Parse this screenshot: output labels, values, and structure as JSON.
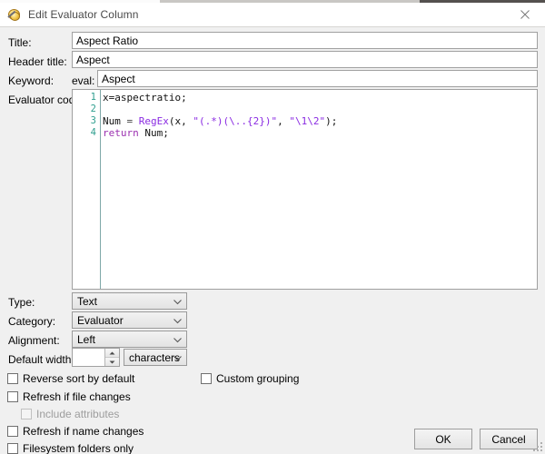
{
  "window": {
    "title": "Edit Evaluator Column",
    "icon": "evaluator-column-icon",
    "close_label": "×"
  },
  "form": {
    "title": {
      "label": "Title:",
      "value": "Aspect Ratio",
      "placeholder": ""
    },
    "header_title": {
      "label": "Header title:",
      "value": "Aspect",
      "placeholder": ""
    },
    "keyword": {
      "label": "Keyword:",
      "prefix": "eval:",
      "value": "Aspect",
      "placeholder": ""
    },
    "evaluator_code": {
      "label": "Evaluator code:",
      "line_numbers": [
        "1",
        "2",
        "3",
        "4"
      ],
      "lines": [
        [
          {
            "t": "x=aspectratio;",
            "c": "tok-plain"
          }
        ],
        [],
        [
          {
            "t": "Num ",
            "c": "tok-plain"
          },
          {
            "t": "= ",
            "c": "tok-punct"
          },
          {
            "t": "RegEx",
            "c": "tok-fn"
          },
          {
            "t": "(x, ",
            "c": "tok-plain"
          },
          {
            "t": "\"(.*)(\\..{2})\"",
            "c": "tok-str"
          },
          {
            "t": ", ",
            "c": "tok-plain"
          },
          {
            "t": "\"\\1\\2\"",
            "c": "tok-str"
          },
          {
            "t": ");",
            "c": "tok-plain"
          }
        ],
        [
          {
            "t": "return ",
            "c": "tok-kw"
          },
          {
            "t": "Num;",
            "c": "tok-plain"
          }
        ]
      ],
      "raw_text": "x=aspectratio;\n\nNum = RegEx(x, \"(.*)(\\..{2})\", \"\\1\\2\");\nreturn Num;"
    },
    "type": {
      "label": "Type:",
      "value": "Text"
    },
    "category": {
      "label": "Category:",
      "value": "Evaluator"
    },
    "alignment": {
      "label": "Alignment:",
      "value": "Left"
    },
    "default_width": {
      "label": "Default width:",
      "value": "",
      "unit": "characters"
    }
  },
  "checkboxes": [
    {
      "label": "Reverse sort by default",
      "checked": false,
      "disabled": false
    },
    {
      "label": "Refresh if file changes",
      "checked": false,
      "disabled": false
    },
    {
      "label": "Include attributes",
      "checked": false,
      "disabled": true
    },
    {
      "label": "Refresh if name changes",
      "checked": false,
      "disabled": false
    },
    {
      "label": "Filesystem folders only",
      "checked": false,
      "disabled": false
    },
    {
      "label": "Custom grouping",
      "checked": false,
      "disabled": false
    }
  ],
  "buttons": {
    "ok": "OK",
    "cancel": "Cancel"
  },
  "colors": {
    "dialog_bg": "#f0f0f0",
    "titlebar_bg": "#ffffff",
    "field_bg": "#ffffff",
    "field_border": "#a0a0a0",
    "gutter_text": "#2f9e8f",
    "keyword": "#9b30b0",
    "string": "#8a2be2"
  }
}
